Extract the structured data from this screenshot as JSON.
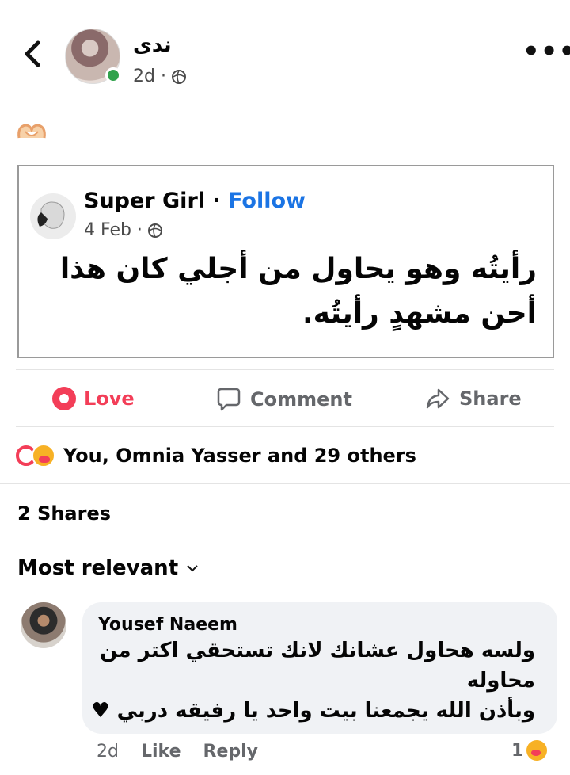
{
  "post": {
    "author": "ندى",
    "time": "2d ·",
    "more_label": "•••",
    "shared": {
      "name": "Super Girl",
      "separator": " · ",
      "follow": "Follow",
      "date": "4 Feb ·",
      "text_line1": "رأيتُه وهو يحاول من أجلي كان هذا",
      "text_line2": "أحن مشهدٍ رأيتُه."
    }
  },
  "actions": {
    "love": "Love",
    "comment": "Comment",
    "share": "Share"
  },
  "reactions_text": "You, Omnia Yasser and 29 others",
  "shares_text": "2 Shares",
  "sort_label": "Most relevant",
  "comment": {
    "author": "Yousef Naeem",
    "line1": "ولسه هحاول عشانك لانك تستحقي اكتر من",
    "line2": "محاوله",
    "line3": "وبأذن الله يجمعنا بيت واحد يا رفيقه دربي ♥",
    "time": "2d",
    "like": "Like",
    "reply": "Reply",
    "reaction_count": "1"
  },
  "colors": {
    "love": "#f33e58",
    "link": "#1b74e4",
    "online": "#31a24c",
    "muted": "#65676b",
    "bubble": "#f0f2f5"
  },
  "icons": [
    "back-chevron-icon",
    "globe-icon",
    "more-options-icon",
    "heart-hands-emoji",
    "love-reaction-icon",
    "comment-icon",
    "share-arrow-icon",
    "care-reaction-icon",
    "chevron-down-icon"
  ]
}
